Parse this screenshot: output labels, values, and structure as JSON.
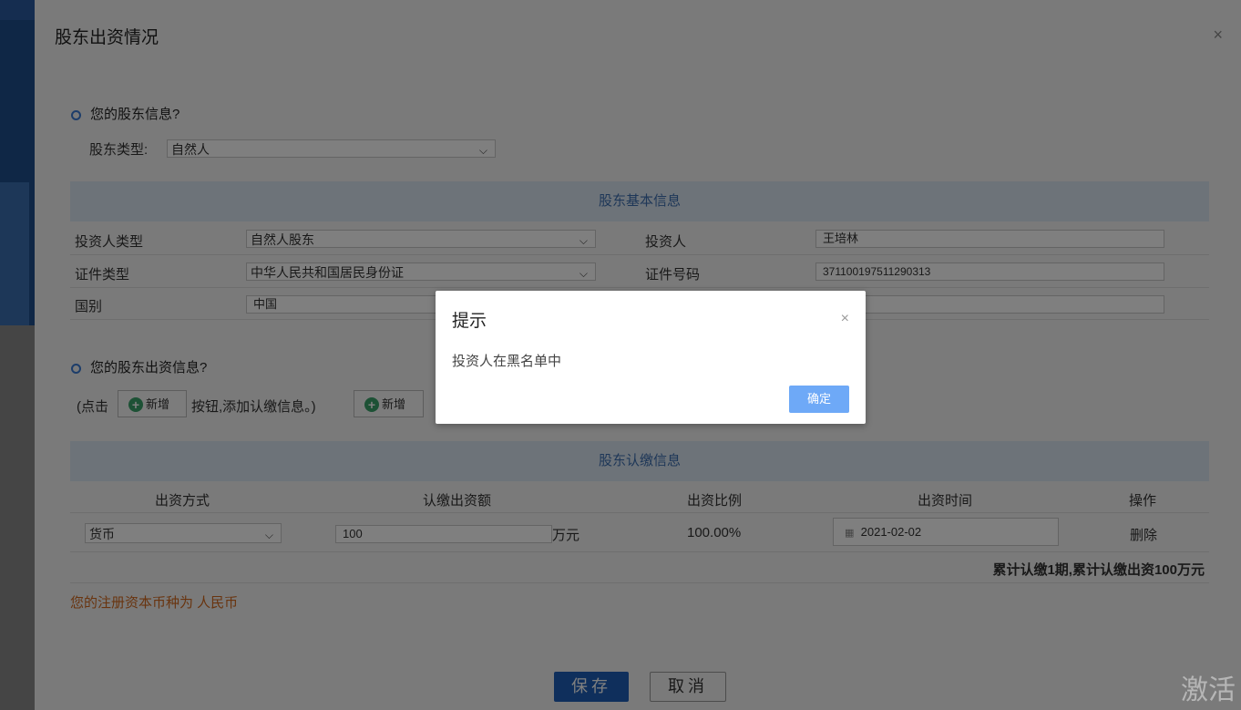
{
  "modal": {
    "title": "股东出资情况",
    "close": "×"
  },
  "section1": {
    "heading": "您的股东信息?",
    "shareholder_type_label": "股东类型:",
    "shareholder_type_value": "自然人"
  },
  "basic_info": {
    "header": "股东基本信息",
    "investor_type_label": "投资人类型",
    "investor_type_value": "自然人股东",
    "investor_label": "投资人",
    "investor_value": "王培林",
    "id_type_label": "证件类型",
    "id_type_value": "中华人民共和国居民身份证",
    "id_number_label": "证件号码",
    "id_number_value": "371100197511290313",
    "country_label": "国别",
    "country_value": "中国"
  },
  "section2": {
    "heading": "您的股东出资信息?",
    "hint_prefix": "(点击",
    "hint_suffix": "按钮,添加认缴信息。)",
    "add_label": "新增",
    "add_button_label": "新增"
  },
  "contribution": {
    "header": "股东认缴信息",
    "columns": [
      "出资方式",
      "认缴出资额",
      "出资比例",
      "出资时间",
      "操作"
    ],
    "row": {
      "method": "货币",
      "amount": "100",
      "unit": "万元",
      "ratio": "100.00%",
      "date": "2021-02-02",
      "action": "删除"
    },
    "summary": "累计认缴1期,累计认缴出资100万元"
  },
  "currency_note": "您的注册资本币种为 人民币",
  "footer": {
    "save": "保存",
    "cancel": "取消"
  },
  "dialog": {
    "title": "提示",
    "message": "投资人在黑名单中",
    "ok": "确定",
    "close": "×"
  },
  "watermark": "激活",
  "icons": {
    "chevron": "chevron-down-icon",
    "plus": "plus-circle-icon",
    "calendar": "calendar-icon"
  }
}
